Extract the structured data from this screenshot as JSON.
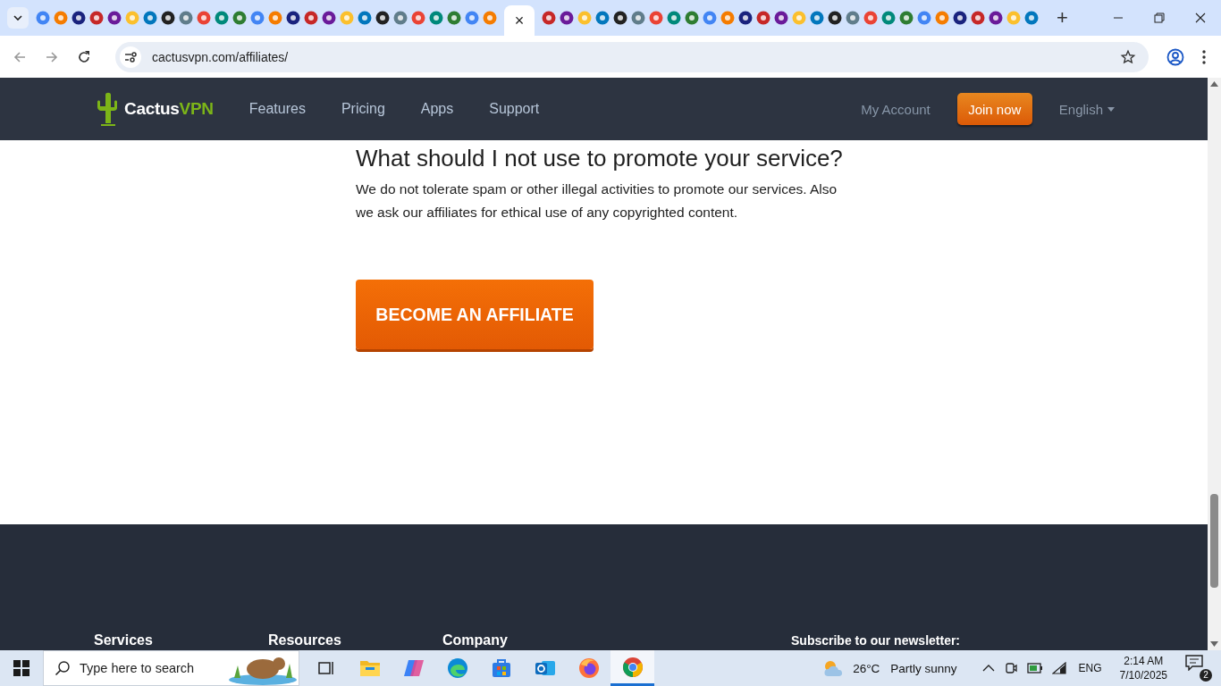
{
  "browser": {
    "tabs": [
      {
        "selected": false
      },
      {
        "selected": false
      },
      {
        "selected": false
      },
      {
        "selected": false
      },
      {
        "selected": false
      },
      {
        "selected": false
      },
      {
        "selected": false
      },
      {
        "selected": false
      },
      {
        "selected": false
      },
      {
        "selected": false
      },
      {
        "selected": false
      },
      {
        "selected": false
      },
      {
        "selected": false
      },
      {
        "selected": false
      },
      {
        "selected": false
      },
      {
        "selected": false
      },
      {
        "selected": false
      },
      {
        "selected": false
      },
      {
        "selected": false
      },
      {
        "selected": false
      },
      {
        "selected": false
      },
      {
        "selected": false
      },
      {
        "selected": false
      },
      {
        "selected": false
      },
      {
        "selected": false
      },
      {
        "selected": false
      },
      {
        "selected": true,
        "close": "×"
      },
      {
        "selected": false
      },
      {
        "selected": false
      },
      {
        "selected": false
      },
      {
        "selected": false
      },
      {
        "selected": false
      },
      {
        "selected": false
      },
      {
        "selected": false
      },
      {
        "selected": false
      },
      {
        "selected": false
      },
      {
        "selected": false
      },
      {
        "selected": false
      },
      {
        "selected": false
      },
      {
        "selected": false
      },
      {
        "selected": false
      },
      {
        "selected": false
      },
      {
        "selected": false
      },
      {
        "selected": false
      },
      {
        "selected": false
      },
      {
        "selected": false
      },
      {
        "selected": false
      },
      {
        "selected": false
      },
      {
        "selected": false
      },
      {
        "selected": false
      },
      {
        "selected": false
      },
      {
        "selected": false
      },
      {
        "selected": false
      },
      {
        "selected": false
      },
      {
        "selected": false
      }
    ],
    "new_tab": "+",
    "url": "cactusvpn.com/affiliates/"
  },
  "header": {
    "logo": {
      "text": "Cactus",
      "accent": "VPN"
    },
    "nav": [
      "Features",
      "Pricing",
      "Apps",
      "Support"
    ],
    "account": "My Account",
    "join": "Join now",
    "language": "English"
  },
  "content": {
    "heading": "What should I not use to promote your service?",
    "paragraph": "We do not tolerate spam or other illegal activities to promote our services. Also we ask our affiliates for ethical use of any copyrighted content.",
    "button": "BECOME AN AFFILIATE"
  },
  "footer": {
    "columns": [
      "Services",
      "Resources",
      "Company"
    ],
    "newsletter": "Subscribe to our newsletter:"
  },
  "taskbar": {
    "search": {
      "placeholder": "Type here to search"
    },
    "apps": [
      {
        "kind": "task-view",
        "selected": false
      },
      {
        "kind": "explorer",
        "selected": false
      },
      {
        "kind": "copilot",
        "selected": false
      },
      {
        "kind": "edge",
        "selected": false
      },
      {
        "kind": "store",
        "selected": false
      },
      {
        "kind": "outlook",
        "selected": false
      },
      {
        "kind": "firefox",
        "selected": false
      },
      {
        "kind": "chrome",
        "selected": true
      }
    ],
    "temperature": "26°C",
    "weather": "Partly sunny",
    "language": "ENG",
    "time": "2:14 AM",
    "date": "7/10/2025",
    "notifications": "2"
  }
}
